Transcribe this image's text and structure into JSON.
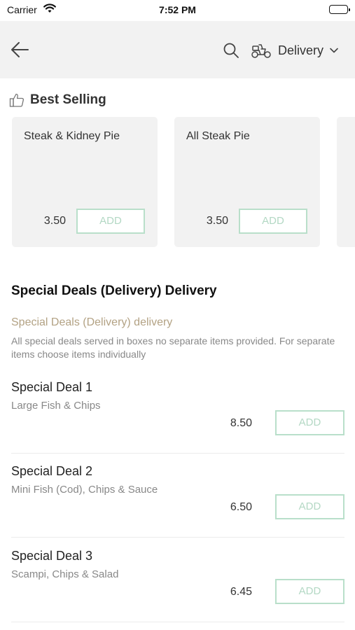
{
  "status_bar": {
    "carrier": "Carrier",
    "time": "7:52 PM",
    "battery_level": 1.0
  },
  "nav": {
    "back_icon": "arrow-left-icon",
    "search_icon": "search-icon",
    "delivery_icon": "scooter-icon",
    "delivery_label": "Delivery",
    "dropdown_icon": "chevron-down-icon"
  },
  "best_selling": {
    "icon": "thumbs-up-icon",
    "title": "Best Selling",
    "items": [
      {
        "name": "Steak & Kidney Pie",
        "price": "3.50",
        "add_label": "ADD"
      },
      {
        "name": "All Steak Pie",
        "price": "3.50",
        "add_label": "ADD"
      }
    ]
  },
  "section": {
    "title": "Special Deals (Delivery) Delivery",
    "subtitle": "Special Deals (Delivery) delivery",
    "description": "All special deals served in boxes no separate items provided. For separate items choose items individually"
  },
  "deals": [
    {
      "name": "Special Deal 1",
      "description": "Large Fish & Chips",
      "price": "8.50",
      "add_label": "ADD"
    },
    {
      "name": "Special Deal 2",
      "description": "Mini Fish (Cod), Chips & Sauce",
      "price": "6.50",
      "add_label": "ADD"
    },
    {
      "name": "Special Deal 3",
      "description": "Scampi, Chips & Salad",
      "price": "6.45",
      "add_label": "ADD"
    }
  ],
  "colors": {
    "accent_border": "#b9dfca",
    "accent_text": "#b3d8c4",
    "subtitle": "#b3a284",
    "nav_bg": "#f2f2f2"
  }
}
